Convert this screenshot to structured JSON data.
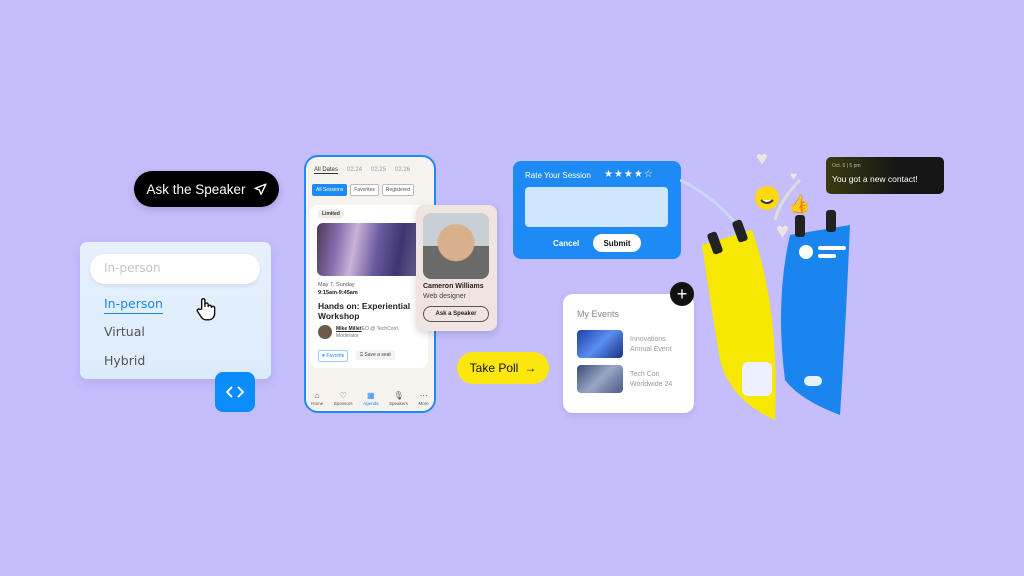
{
  "ask_speaker": {
    "label": "Ask the Speaker",
    "icon": "send-icon"
  },
  "dropdown": {
    "placeholder": "In-person",
    "options": [
      "In-person",
      "Virtual",
      "Hybrid"
    ],
    "selected": "In-person"
  },
  "code_button": {
    "icon": "code-icon"
  },
  "phone": {
    "date_tabs": [
      "All Dates",
      "02.24",
      "02.25",
      "02.26"
    ],
    "filters": [
      "All Sessions",
      "Favorites",
      "Registered"
    ],
    "session": {
      "badge": "Limited",
      "date": "May 7, Sunday",
      "time": "9:15am-9:45am",
      "title": "Hands on: Experiential Workshop",
      "moderator_name": "Mike Miller",
      "moderator_role": "CEO @ TechConf,",
      "moderator_sub": "Moderator",
      "favorite_label": "Favorite",
      "seat_label": "Save a seat"
    },
    "tabs": [
      {
        "label": "Home",
        "icon": "⌂"
      },
      {
        "label": "Sponsors",
        "icon": "♡"
      },
      {
        "label": "Agenda",
        "icon": "▦"
      },
      {
        "label": "Speakers",
        "icon": "🎙"
      },
      {
        "label": "More",
        "icon": "⋯"
      }
    ]
  },
  "speaker_card": {
    "name": "Cameron Williams",
    "role": "Web designer",
    "button": "Ask a Speaker"
  },
  "rate_card": {
    "title": "Rate Your Session",
    "stars": "★★★★☆",
    "rating": 4,
    "max_rating": 5,
    "cancel": "Cancel",
    "submit": "Submit"
  },
  "poll": {
    "label": "Take Poll",
    "icon": "→"
  },
  "events": {
    "title": "My Events",
    "items": [
      {
        "line1": "Innovations",
        "line2": "Annual Event"
      },
      {
        "line1": "Tech Con",
        "line2": "Worldwide 24"
      }
    ],
    "add_icon": "+"
  },
  "notification": {
    "time": "Oct. 6 | 5 pm",
    "message": "You got a new contact!"
  },
  "colors": {
    "background": "#c5bdfc",
    "primary_blue": "#1e8af5",
    "yellow": "#fbe70d"
  }
}
